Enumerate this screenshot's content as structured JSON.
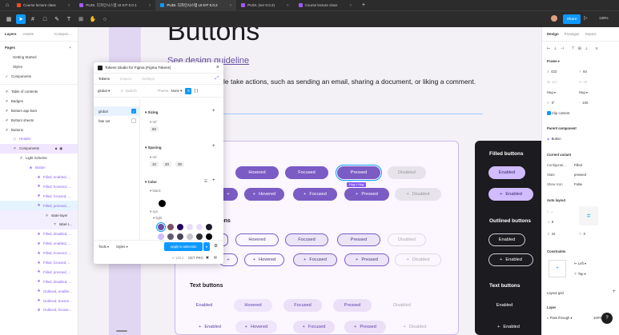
{
  "tabs": [
    {
      "label": "Course lecture class",
      "color": "#f24e1e"
    },
    {
      "label": "PUDI. 디자인시스템 UI KIT 0.0.1",
      "color": "#a259ff"
    },
    {
      "label": "PUDI. 디자인시스템 UI KIT 0.0.2",
      "color": "#0d99ff"
    },
    {
      "label": "PUDI. (ver 0.0.2)",
      "color": "#a259ff"
    },
    {
      "label": "Course lecture class",
      "color": "#a259ff"
    }
  ],
  "toolbar": {
    "share": "Share",
    "zoom": "130%"
  },
  "left": {
    "tabs": [
      "Layers",
      "Assets",
      "Compon..."
    ],
    "pages_title": "Pages",
    "pages": [
      "Getting Started",
      "Styles",
      "Components"
    ],
    "layers": [
      "Table of contents",
      "Badges",
      "Bottom app bars",
      "Bottom sheets",
      "Buttons",
      "Header",
      "Components",
      "Light Scheme",
      "Button",
      "Filled, enabled, ...",
      "Filled, hovered, ...",
      "Filled, focused, ...",
      "Filled, pressed, ...",
      "state-layer",
      "label-t...",
      "Filled, disabled, ...",
      "Filled, enabled, ...",
      "Filled, hovered, ...",
      "Filled, focused, ...",
      "Filled, pressed, ...",
      "Filled, disabled, ...",
      "Outlined, enable...",
      "Outlined, hovere...",
      "Outlined, focuse..."
    ]
  },
  "canvas": {
    "heading": "Buttons",
    "link": "See design guideline",
    "desc": "le take actions, such as sending an email, sharing a document, or liking a comment.",
    "outlined": "tons",
    "text_title": "Text buttons",
    "filled_dark": "Filled buttons",
    "outlined_dark": "Outlined buttons",
    "text_dark": "Text buttons",
    "states": [
      "Enabled",
      "Hovered",
      "Focused",
      "Pressed",
      "Disabled"
    ],
    "plus": "+",
    "hug": "Hug × Hug"
  },
  "dialog": {
    "title": "Tokens Studio for Figma (Figma Tokens)",
    "tabs": [
      "Tokens",
      "Inspect",
      "Settings"
    ],
    "set": "global",
    "search": "Search",
    "theme_label": "Theme:",
    "theme_value": "None",
    "sets": [
      "global",
      "fate set"
    ],
    "sizing": "Sizing",
    "ref": "ref",
    "sizing_vals": [
      "60"
    ],
    "spacing": "Spacing",
    "spacing_vals": [
      "10",
      "20",
      "30"
    ],
    "color": "Color",
    "black": "black",
    "sys": "sys",
    "light": "light",
    "tools": "Tools",
    "styles": "Styles",
    "apply": "Apply to selection",
    "version": "V 129.2",
    "get_pro": "GET PRO",
    "swatches": [
      "#6750a4",
      "#7d5260",
      "#21005d",
      "#e8def8",
      "#eaddff",
      "#d0bcff",
      "#1d192b",
      "#625b71",
      "#4a4458",
      "#313033",
      "#cac4d0",
      "#000000"
    ]
  },
  "right": {
    "tabs": [
      "Design",
      "Prototype",
      "Inspect"
    ],
    "frame": "Frame",
    "x": "423",
    "y": "84",
    "w": "117",
    "h": "40",
    "hug1": "Hug",
    "hug2": "Hug",
    "rot": "0°",
    "rad": "100",
    "clip": "Clip content",
    "parent": "Parent component",
    "parent_name": "Button",
    "current": "Current variant",
    "props": [
      [
        "Configurati...",
        "Filled"
      ],
      [
        "State",
        "pressed"
      ],
      [
        "Show Icon",
        "False"
      ]
    ],
    "auto": "Auto layout",
    "gap": "8",
    "pad": "24",
    "pady": "0",
    "constraints": "Constraints",
    "left": "Left",
    "top": "Top",
    "grid": "Layout grid",
    "layer": "Layer",
    "pass": "Pass through",
    "opacity": "100%"
  }
}
